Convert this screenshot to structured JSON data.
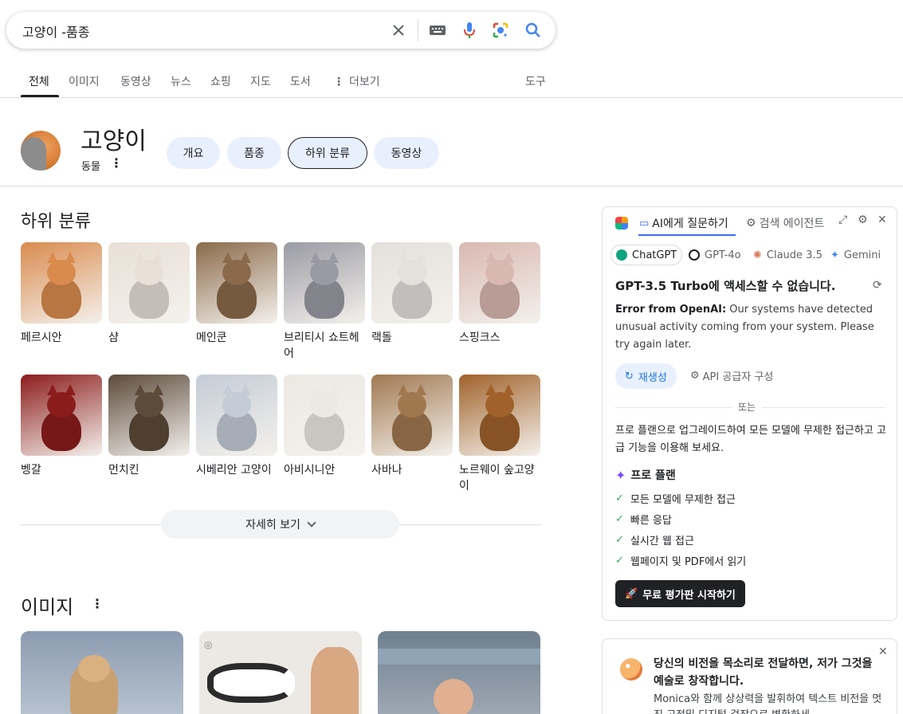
{
  "search": {
    "query": "고양이 -품종",
    "clear_icon": "close-icon",
    "keyboard_icon": "keyboard-icon",
    "mic_icon": "mic-icon",
    "lens_icon": "lens-icon",
    "search_icon": "search-icon"
  },
  "tabs": [
    {
      "label": "전체",
      "active": true
    },
    {
      "label": "이미지"
    },
    {
      "label": "동영상"
    },
    {
      "label": "뉴스"
    },
    {
      "label": "쇼핑"
    },
    {
      "label": "지도"
    },
    {
      "label": "도서"
    },
    {
      "label": "더보기"
    }
  ],
  "tools_label": "도구",
  "entity": {
    "title": "고양이",
    "subtitle": "동물",
    "chips": [
      "개요",
      "품종",
      "하위 분류",
      "동영상"
    ],
    "selected_chip": "하위 분류"
  },
  "subcategory": {
    "title": "하위 분류",
    "items": [
      {
        "label": "페르시안",
        "color": "#d98b4e"
      },
      {
        "label": "샴",
        "color": "#e8e0d6"
      },
      {
        "label": "메인쿤",
        "color": "#8a6a4a"
      },
      {
        "label": "브리티시 쇼트헤어",
        "color": "#9a9aa4"
      },
      {
        "label": "랙돌",
        "color": "#e4e0dc"
      },
      {
        "label": "스핑크스",
        "color": "#d8b8b0"
      },
      {
        "label": "벵갈",
        "color": "#8b1c1c"
      },
      {
        "label": "먼치킨",
        "color": "#5c4a3a"
      },
      {
        "label": "시베리안 고양이",
        "color": "#c4ccd6"
      },
      {
        "label": "아비시니안",
        "color": "#ece8e2"
      },
      {
        "label": "사바나",
        "color": "#a07850"
      },
      {
        "label": "노르웨이 숲고양이",
        "color": "#a0622a"
      }
    ],
    "more_label": "자세히 보기"
  },
  "images_section": {
    "title": "이미지",
    "cards": [
      {
        "color": "#8c9bb0"
      },
      {
        "color": "#e8e4e0"
      },
      {
        "color": "#7a8a9a"
      }
    ]
  },
  "panel": {
    "tab_ask": "AI에게 질문하기",
    "tab_agent": "검색 에이전트",
    "models": [
      {
        "label": "ChatGPT",
        "color": "#10a37f",
        "selected": true
      },
      {
        "label": "GPT-4o",
        "color": "#202124"
      },
      {
        "label": "Claude 3.5",
        "color": "#d97757"
      },
      {
        "label": "Gemini",
        "color": "#4285f4"
      }
    ],
    "heading": "GPT-3.5 Turbo에 액세스할 수 없습니다.",
    "error_label": "Error from OpenAI:",
    "error_text": " Our systems have detected unusual activity coming from your system. Please try again later.",
    "regen_label": "재생성",
    "api_label": "API 공급자 구성",
    "or_label": "또는",
    "upgrade_text": "프로 플랜으로 업그레이드하여 모든 모델에 무제한 접근하고 고급 기능을 이용해 보세요.",
    "plan_title": "프로 플랜",
    "features": [
      "모든 모델에 무제한 접근",
      "빠른 응답",
      "실시간 웹 접근",
      "웹페이지 및 PDF에서 읽기"
    ],
    "trial_label": "무료 평가판 시작하기"
  },
  "panel2": {
    "title": "당신의 비전을 목소리로 전달하면, 저가 그것을 예술로 창작합니다.",
    "text": "Monica와 함께 상상력을 발휘하여 텍스트 비전을 멋진 고정및 디지털 걸작으로 변환하세"
  }
}
